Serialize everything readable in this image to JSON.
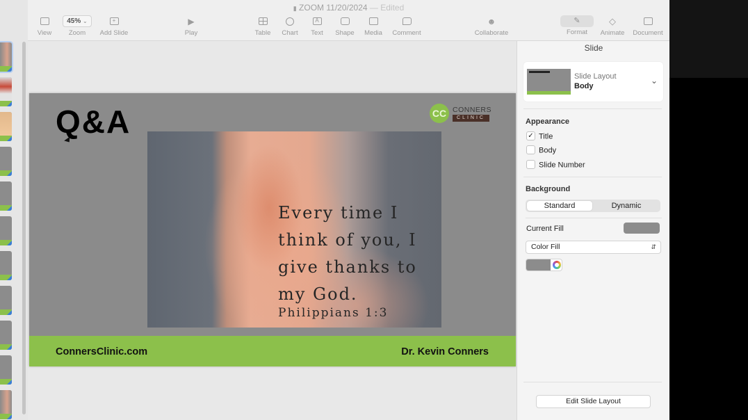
{
  "window": {
    "title": "ZOOM 11/20/2024",
    "status": "— Edited"
  },
  "toolbar": {
    "zoom_value": "45%",
    "items": [
      {
        "label": "View",
        "icon": "sidebar-icon"
      },
      {
        "label": "Zoom",
        "icon": "zoom-dropdown"
      },
      {
        "label": "Add Slide",
        "icon": "add-slide-icon"
      },
      {
        "label": "Play",
        "icon": "play-icon"
      },
      {
        "label": "Table",
        "icon": "table-icon"
      },
      {
        "label": "Chart",
        "icon": "chart-icon"
      },
      {
        "label": "Text",
        "icon": "text-icon"
      },
      {
        "label": "Shape",
        "icon": "shape-icon"
      },
      {
        "label": "Media",
        "icon": "media-icon"
      },
      {
        "label": "Comment",
        "icon": "comment-icon"
      },
      {
        "label": "Collaborate",
        "icon": "collaborate-icon"
      },
      {
        "label": "Format",
        "icon": "format-brush-icon"
      },
      {
        "label": "Animate",
        "icon": "animate-icon"
      },
      {
        "label": "Document",
        "icon": "document-icon"
      }
    ]
  },
  "slide": {
    "title": "Q&A",
    "logo": {
      "line1": "CONNERS",
      "line2": "CLINIC",
      "mark": "CC"
    },
    "verse": "Every time I think of you, I give thanks to my God.",
    "reference": "Philippians 1:3",
    "footer_left": "ConnersClinic.com",
    "footer_right": "Dr. Kevin Conners",
    "colors": {
      "background": "#8b8b8b",
      "footer": "#8cc04b"
    }
  },
  "inspector": {
    "header": "Slide",
    "layout_label": "Slide Layout",
    "layout_name": "Body",
    "appearance_title": "Appearance",
    "appearance_options": [
      {
        "label": "Title",
        "checked": true
      },
      {
        "label": "Body",
        "checked": false
      },
      {
        "label": "Slide Number",
        "checked": false
      }
    ],
    "background_title": "Background",
    "background_modes": [
      "Standard",
      "Dynamic"
    ],
    "background_selected": "Standard",
    "current_fill_label": "Current Fill",
    "fill_type": "Color Fill",
    "fill_color": "#8c8c8c",
    "edit_layout_button": "Edit Slide Layout"
  }
}
